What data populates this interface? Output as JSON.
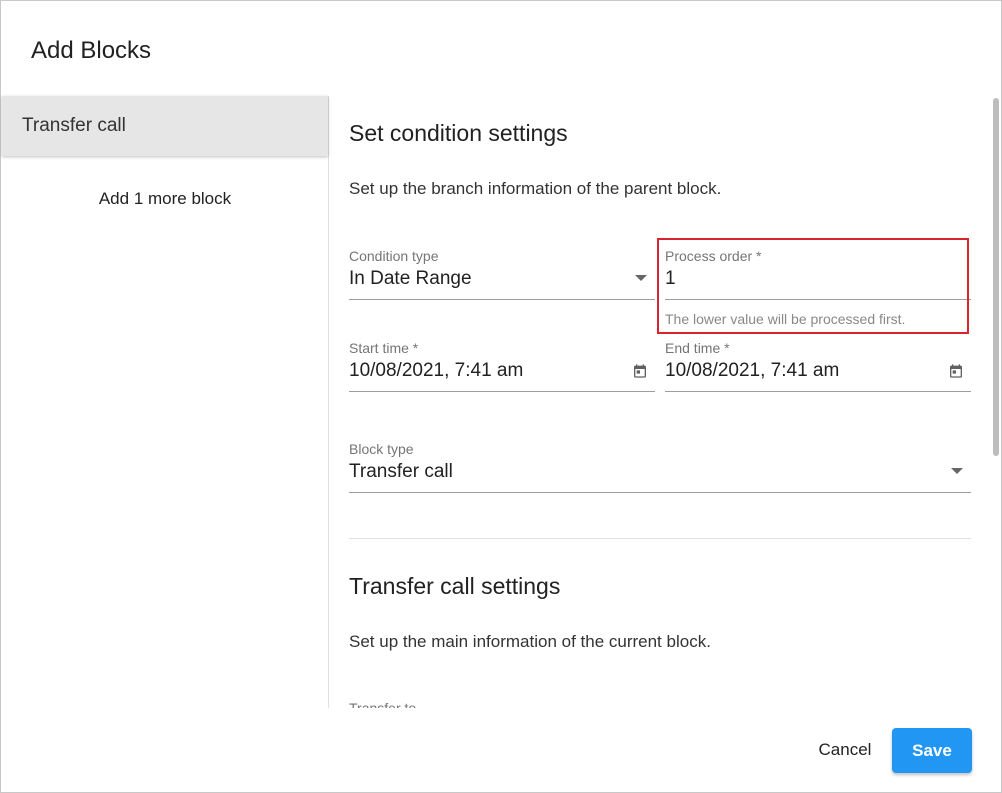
{
  "dialog": {
    "title": "Add Blocks"
  },
  "sidebar": {
    "items": [
      {
        "label": "Transfer call"
      }
    ],
    "add_more_label": "Add 1 more block"
  },
  "condition_section": {
    "title": "Set condition settings",
    "description": "Set up the branch information of the parent block.",
    "condition_type": {
      "label": "Condition type",
      "value": "In Date Range"
    },
    "process_order": {
      "label": "Process order *",
      "value": "1",
      "helper": "The lower value will be processed first."
    },
    "start_time": {
      "label": "Start time *",
      "value": "10/08/2021, 7:41 am"
    },
    "end_time": {
      "label": "End time *",
      "value": "10/08/2021, 7:41 am"
    },
    "block_type": {
      "label": "Block type",
      "value": "Transfer call"
    }
  },
  "transfer_section": {
    "title": "Transfer call settings",
    "description": "Set up the main information of the current block.",
    "next_field_label": "Transfer to"
  },
  "actions": {
    "cancel_label": "Cancel",
    "save_label": "Save"
  },
  "colors": {
    "primary": "#2196f3",
    "highlight": "#d9232d",
    "sidebar_selected": "#e6e6e6"
  },
  "icons": {
    "date_picker": "calendar-icon",
    "dropdown": "caret-down-icon"
  }
}
